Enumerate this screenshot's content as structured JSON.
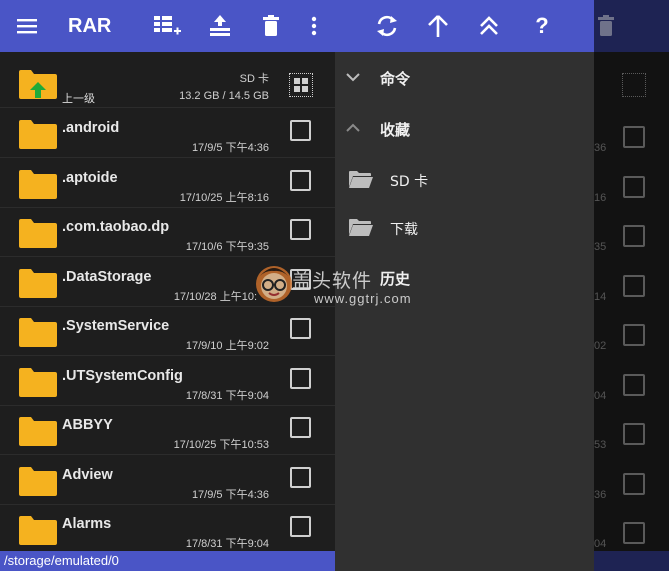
{
  "app": {
    "title": "RAR"
  },
  "toolbar": {
    "icons": [
      "menu-icon",
      "select-all-icon",
      "extract-icon",
      "delete-icon",
      "more-vert-icon",
      "refresh-icon",
      "up-icon",
      "double-up-icon",
      "help-icon"
    ]
  },
  "storage": {
    "label": "SD 卡",
    "usage": "13.2 GB / 14.5 GB"
  },
  "parent": {
    "label": "上一级"
  },
  "files": [
    {
      "name": ".android",
      "date": "17/9/5 下午4:36"
    },
    {
      "name": ".aptoide",
      "date": "17/10/25 上午8:16"
    },
    {
      "name": ".com.taobao.dp",
      "date": "17/10/6 下午9:35"
    },
    {
      "name": ".DataStorage",
      "date": "17/10/28 上午10:"
    },
    {
      "name": ".SystemService",
      "date": "17/9/10 上午9:02"
    },
    {
      "name": ".UTSystemConfig",
      "date": "17/8/31 下午9:04"
    },
    {
      "name": "ABBYY",
      "date": "17/10/25 下午10:53"
    },
    {
      "name": "Adview",
      "date": "17/9/5 下午4:36"
    },
    {
      "name": "Alarms",
      "date": "17/8/31 下午9:04"
    }
  ],
  "drawer": {
    "commands": "命令",
    "favorites": "收藏",
    "sd_card": "SD 卡",
    "download": "下载",
    "history": "历史"
  },
  "background_dates": [
    "36",
    "16",
    "35",
    "14",
    "02",
    "04",
    "53",
    "36",
    "04"
  ],
  "status_path": "/storage/emulated/0",
  "watermark": {
    "line1": "盖头软件",
    "line2": "www.ggtrj.com"
  },
  "colors": {
    "toolbar": "#4a55c6",
    "folder": "#f5b21f",
    "list_bg": "#1e1e1e",
    "drawer_bg": "#303030"
  }
}
